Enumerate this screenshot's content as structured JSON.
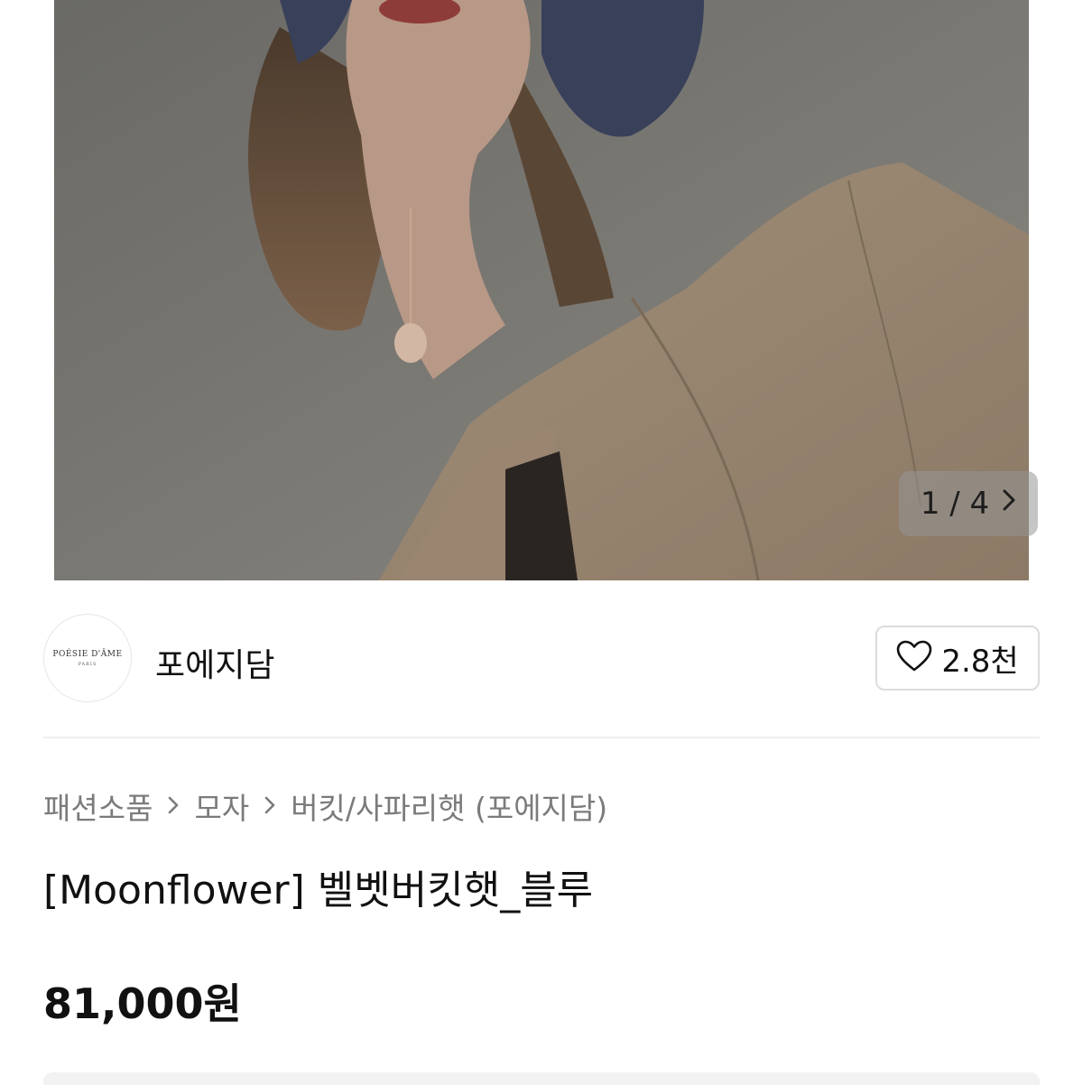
{
  "gallery": {
    "current": "1",
    "separator": "/",
    "total": "4",
    "next_icon": "chevron-right-icon"
  },
  "shop": {
    "logo_line1": "POÉSIE D'ÂME",
    "logo_line2": "PARIS",
    "name": "포에지담",
    "likes": "2.8천",
    "like_icon": "heart-outline-icon"
  },
  "breadcrumb": {
    "items": [
      "패션소품",
      "모자",
      "버킷/사파리햇 (포에지담)"
    ],
    "separator_icon": "chevron-right-icon"
  },
  "product": {
    "title": "[Moonflower] 벨벳버킷햇_블루",
    "price": "81,000원"
  },
  "colors": {
    "text_primary": "#111111",
    "text_secondary": "#7b7b7b",
    "border": "#dcdcdc"
  }
}
